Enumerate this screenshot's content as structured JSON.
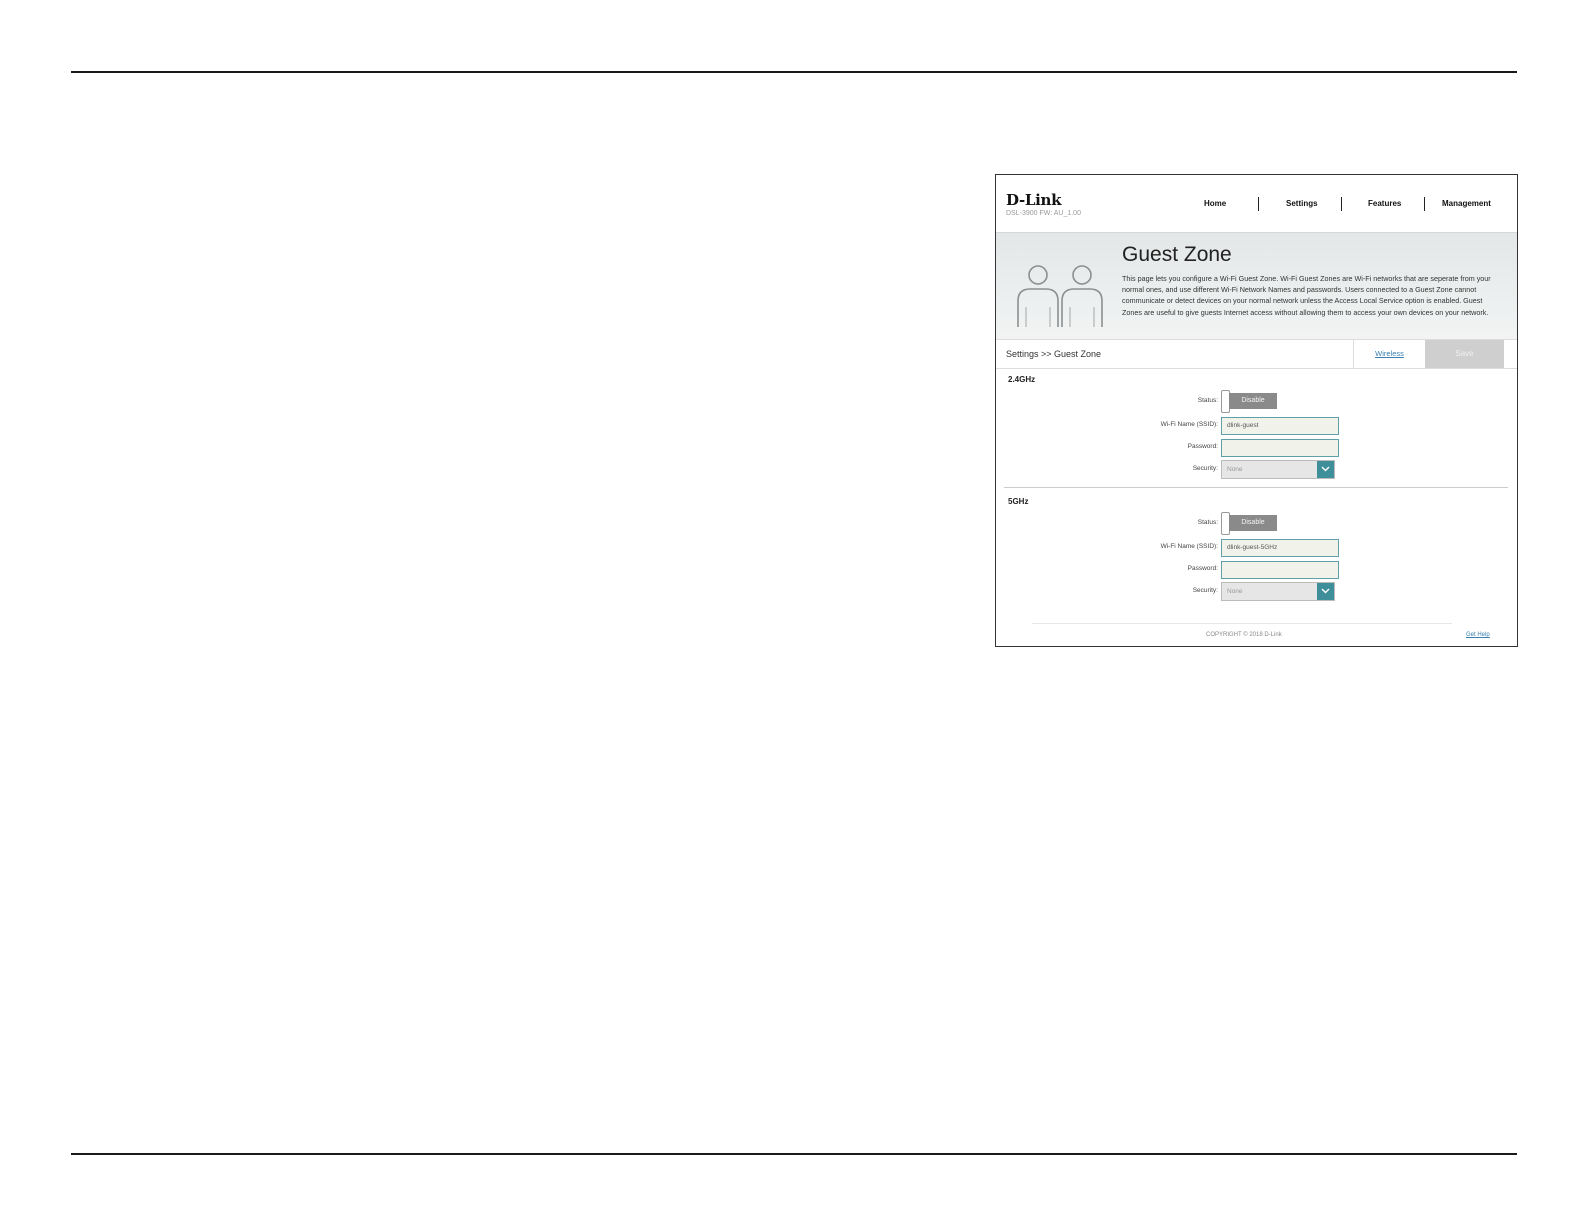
{
  "app": {
    "logo": "D-Link",
    "model": "DSL-3900   FW: AU_1.00"
  },
  "nav": [
    {
      "label": "Home"
    },
    {
      "label": "Settings"
    },
    {
      "label": "Features"
    },
    {
      "label": "Management"
    }
  ],
  "banner": {
    "title": "Guest Zone",
    "description": "This page lets you configure a Wi-Fi Guest Zone. Wi-Fi Guest Zones are Wi-Fi networks that are seperate from your normal ones, and use different Wi-Fi Network Names and passwords. Users connected to a Guest Zone cannot communicate or detect devices on your normal network unless the Access Local Service option is enabled. Guest Zones are useful to give guests Internet access without allowing them to access your own devices on your network.",
    "icon": "two-people-icon"
  },
  "toolbar": {
    "breadcrumb": "Settings >> Guest Zone",
    "wireless_link": "Wireless",
    "save_label": "Save"
  },
  "band24": {
    "title": "2.4GHz",
    "status_label": "Status:",
    "status_value": "Disable",
    "ssid_label": "Wi-Fi Name (SSID):",
    "ssid_value": "dlink-guest",
    "password_label": "Password:",
    "password_value": "",
    "security_label": "Security:",
    "security_value": "None"
  },
  "band5": {
    "title": "5GHz",
    "status_label": "Status:",
    "status_value": "Disable",
    "ssid_label": "Wi-Fi Name (SSID):",
    "ssid_value": "dlink-guest-5GHz",
    "password_label": "Password:",
    "password_value": "",
    "security_label": "Security:",
    "security_value": "None"
  },
  "footer": {
    "copyright": "COPYRIGHT © 2018 D-Link",
    "help_link": "Get Help"
  },
  "colors": {
    "accent": "#3e8f9a",
    "link": "#3a7fb0",
    "toggle_off": "#8a8a8a"
  }
}
